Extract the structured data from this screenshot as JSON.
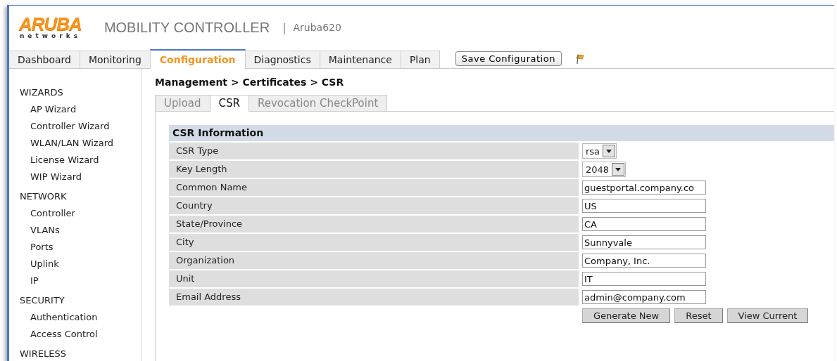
{
  "header": {
    "logo": "ARUBA",
    "logo_subtitle": "networks",
    "product": "MOBILITY CONTROLLER",
    "separator": "|",
    "device": "Aruba620"
  },
  "main_tabs": [
    {
      "label": "Dashboard",
      "selected": false
    },
    {
      "label": "Monitoring",
      "selected": false
    },
    {
      "label": "Configuration",
      "selected": true
    },
    {
      "label": "Diagnostics",
      "selected": false
    },
    {
      "label": "Maintenance",
      "selected": false
    },
    {
      "label": "Plan",
      "selected": false
    }
  ],
  "save_button": "Save Configuration",
  "sidebar": {
    "sections": [
      {
        "title": "WIZARDS",
        "items": [
          "AP Wizard",
          "Controller Wizard",
          "WLAN/LAN Wizard",
          "License Wizard",
          "WIP Wizard"
        ]
      },
      {
        "title": "NETWORK",
        "items": [
          "Controller",
          "VLANs",
          "Ports",
          "Uplink",
          "IP"
        ]
      },
      {
        "title": "SECURITY",
        "items": [
          "Authentication",
          "Access Control"
        ]
      },
      {
        "title": "WIRELESS"
      }
    ]
  },
  "breadcrumb": "Management > Certificates > CSR",
  "sub_tabs": [
    {
      "label": "Upload",
      "selected": false
    },
    {
      "label": "CSR",
      "selected": true
    },
    {
      "label": "Revocation CheckPoint",
      "selected": false
    }
  ],
  "csr_form": {
    "title": "CSR Information",
    "fields": [
      {
        "label": "CSR Type",
        "kind": "select",
        "value": "rsa"
      },
      {
        "label": "Key Length",
        "kind": "select",
        "value": "2048"
      },
      {
        "label": "Common Name",
        "kind": "text",
        "value": "guestportal.company.co"
      },
      {
        "label": "Country",
        "kind": "text",
        "value": "US"
      },
      {
        "label": "State/Province",
        "kind": "text",
        "value": "CA"
      },
      {
        "label": "City",
        "kind": "text",
        "value": "Sunnyvale"
      },
      {
        "label": "Organization",
        "kind": "text",
        "value": "Company, Inc."
      },
      {
        "label": "Unit",
        "kind": "text",
        "value": "IT"
      },
      {
        "label": "Email Address",
        "kind": "text",
        "value": "admin@company.com"
      }
    ],
    "buttons": [
      "Generate New",
      "Reset",
      "View Current"
    ]
  }
}
